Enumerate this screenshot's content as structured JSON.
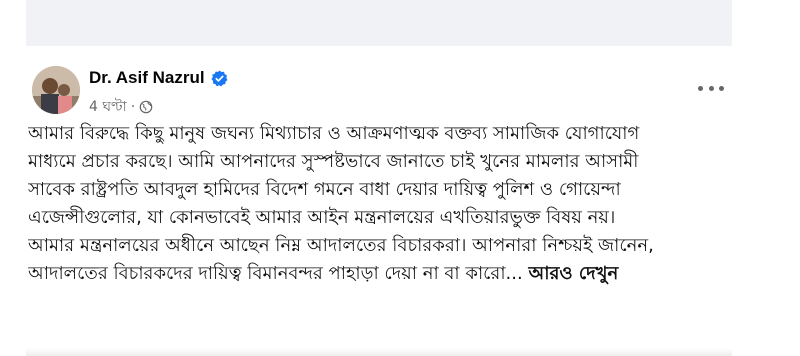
{
  "post": {
    "author_name": "Dr. Asif Nazrul",
    "timestamp": "4 ঘণ্টা",
    "separator": "·",
    "lines": [
      "আমার বিরুদ্ধে কিছু মানুষ জঘন্য মিথ্যাচার ও আক্রমণাত্মক বক্তব্য সামাজিক যোগাযোগ",
      "মাধ্যমে প্রচার করছে। আমি আপনাদের সুস্পষ্টভাবে জানাতে চাই খুনের মামলার আসামী",
      "সাবেক রাষ্ট্রপতি আবদুল হামিদের বিদেশ গমনে বাধা দেয়ার দায়িত্ব পুলিশ ও গোয়েন্দা",
      "এজেন্সীগুলোর, যা কোনভাবেই আমার আইন মন্ত্রনালয়ের এখতিয়ারভুক্ত বিষয় নয়।",
      "আমার মন্ত্রনালয়ের অধীনে আছেন নিম্ন আদালতের বিচারকরা। আপনারা নিশ্চয়ই জানেন,",
      "আদালতের বিচারকদের দায়িত্ব বিমানবন্দর পাহাড়া দেয়া না বা কারো..."
    ],
    "see_more": "আরও দেখুন",
    "icons": {
      "verified": "verified-badge-icon",
      "audience": "globe-icon",
      "more": "more-options-icon"
    },
    "colors": {
      "verified": "#1877f2",
      "secondary_text": "#65676b",
      "feed_background": "#f0f2f5"
    }
  }
}
